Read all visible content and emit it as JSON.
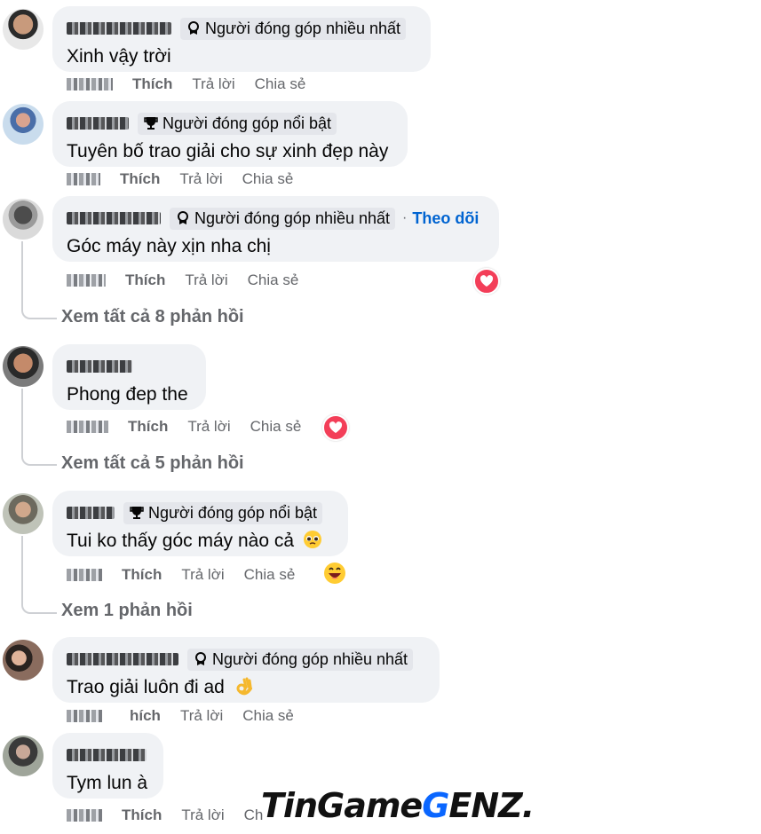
{
  "colors": {
    "bubble": "#f0f2f5",
    "meta_text": "#65676b",
    "follow": "#0064d1",
    "heart": "#f33e58",
    "watermark_accent": "#0a66ff"
  },
  "actions": {
    "like": "Thích",
    "reply": "Trả lời",
    "share": "Chia sẻ"
  },
  "comments": [
    {
      "badge": "Người đóng góp nhiều nhất",
      "badge_icon": "medal-icon",
      "text": "Xinh vậy trời"
    },
    {
      "badge": "Người đóng góp nổi bật",
      "badge_icon": "trophy-icon",
      "text": "Tuyên bố trao giải cho sự xinh đẹp này"
    },
    {
      "badge": "Người đóng góp nhiều nhất",
      "badge_icon": "medal-icon",
      "follow": "Theo dõi",
      "text": "Góc máy này xịn nha chị",
      "reaction": "heart-icon",
      "replies": "Xem tất cả 8 phản hồi"
    },
    {
      "text": "Phong đep the",
      "reaction": "heart-icon",
      "replies": "Xem tất cả 5 phản hồi"
    },
    {
      "badge": "Người đóng góp nổi bật",
      "badge_icon": "trophy-icon",
      "text": "Tui ko thấy góc máy nào cả",
      "text_emoji": "pleading-face-icon",
      "reaction": "grinning-face-icon",
      "replies": "Xem 1 phản hồi"
    },
    {
      "badge": "Người đóng góp nhiều nhất",
      "badge_icon": "medal-icon",
      "text": "Trao giải luôn đi ad",
      "text_emoji": "ok-hand-icon",
      "like_partial": "hích"
    },
    {
      "text": "Tym lun à",
      "share_partial": "Ch"
    }
  ],
  "watermark": {
    "part1": "TinGame",
    "part2": "G",
    "part3": "ENZ."
  }
}
